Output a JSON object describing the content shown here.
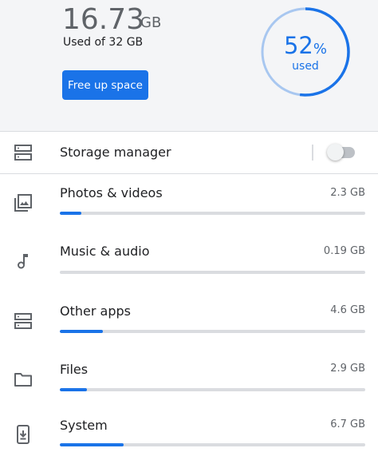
{
  "summary": {
    "used_amount": "16.73",
    "used_unit": "GB",
    "used_of": "Used of 32 GB",
    "free_button": "Free up space",
    "ring_percent_number": "52",
    "ring_percent_symbol": "%",
    "ring_used_label": "used",
    "used_fraction": 0.52
  },
  "storage_manager": {
    "label": "Storage manager",
    "enabled": false,
    "icon": "storage-icon"
  },
  "categories": [
    {
      "label": "Photos & videos",
      "size": "2.3 GB",
      "icon": "photo-icon",
      "fraction": 0.07
    },
    {
      "label": "Music & audio",
      "size": "0.19 GB",
      "icon": "music-note-icon",
      "fraction": 0.0
    },
    {
      "label": "Other apps",
      "size": "4.6 GB",
      "icon": "apps-storage-icon",
      "fraction": 0.14
    },
    {
      "label": "Files",
      "size": "2.9 GB",
      "icon": "folder-icon",
      "fraction": 0.09
    },
    {
      "label": "System",
      "size": "6.7 GB",
      "icon": "phone-download-icon",
      "fraction": 0.21
    }
  ],
  "colors": {
    "accent": "#1a73e8",
    "track": "#dadce0",
    "header_bg": "#f4f5f7",
    "ring_light": "#a8c7f0"
  }
}
